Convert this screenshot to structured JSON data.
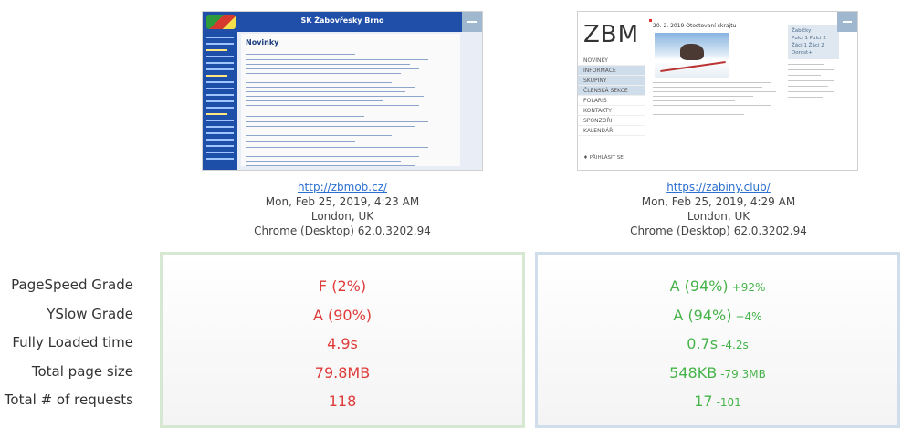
{
  "left": {
    "thumbnail": {
      "site_title": "SK Žabovřesky Brno",
      "heading": "Novinky"
    },
    "url": "http://zbmob.cz/",
    "date": "Mon, Feb 25, 2019, 4:23 AM",
    "location": "London, UK",
    "browser": "Chrome (Desktop) 62.0.3202.94",
    "metrics": {
      "pagespeed": "F (2%)",
      "yslow": "A (90%)",
      "loaded": "4.9s",
      "size": "79.8MB",
      "requests": "118"
    }
  },
  "right": {
    "thumbnail": {
      "logo": "ZBM",
      "post_title": "20. 2. 2019    Otestovaní skrajtu",
      "nav": [
        "NOVINKY",
        "INFORMACE",
        "SKUPINY",
        "ČLENSKÁ SEKCE",
        "POLARIS",
        "KONTAKTY",
        "SPONZOŘI",
        "KALENDÁŘ"
      ],
      "login": "♦ PŘIHLÁSIT SE",
      "box_lines": [
        "Žabičky",
        "Pulci 1   Pulci 2",
        "Žáci 1   Žáci 2",
        "Dorost+"
      ]
    },
    "url": "https://zabiny.club/",
    "date": "Mon, Feb 25, 2019, 4:29 AM",
    "location": "London, UK",
    "browser": "Chrome (Desktop) 62.0.3202.94",
    "metrics": {
      "pagespeed": "A (94%)",
      "pagespeed_delta": "+92%",
      "yslow": "A (94%)",
      "yslow_delta": "+4%",
      "loaded": "0.7s",
      "loaded_delta": "-4.2s",
      "size": "548KB",
      "size_delta": "-79.3MB",
      "requests": "17",
      "requests_delta": "-101"
    }
  },
  "labels": {
    "pagespeed": "PageSpeed Grade",
    "yslow": "YSlow Grade",
    "loaded": "Fully Loaded time",
    "size": "Total page size",
    "requests": "Total # of requests"
  },
  "colors": {
    "bad": "#e03a3a",
    "good": "#46b34a",
    "link": "#2a6fd1"
  }
}
